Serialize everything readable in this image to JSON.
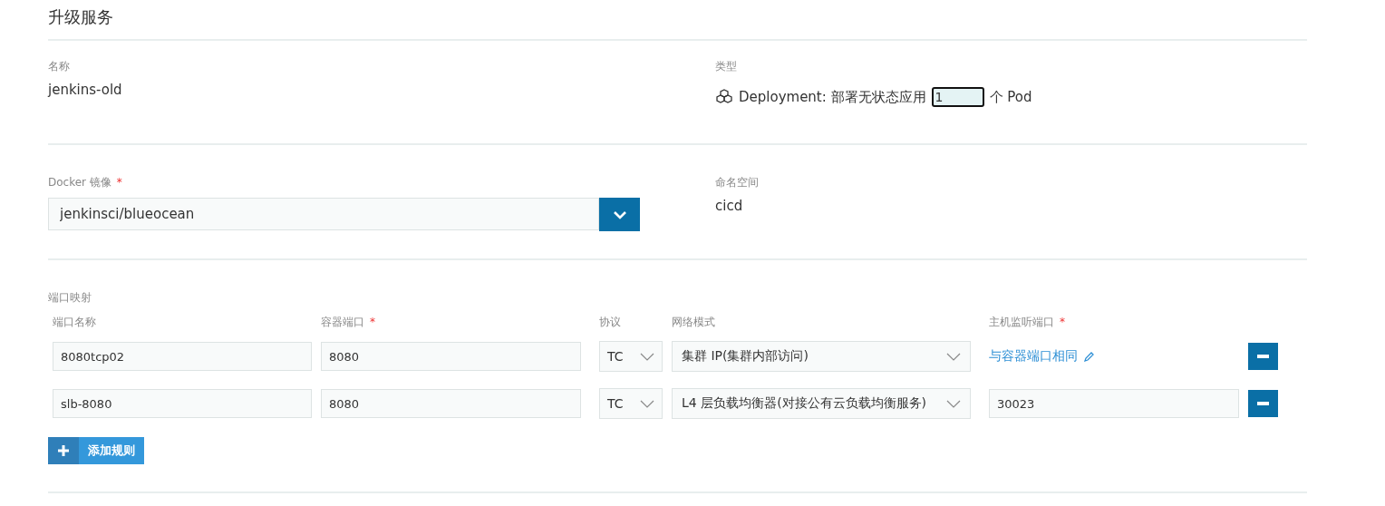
{
  "title": "升级服务",
  "name": {
    "label": "名称",
    "value": "jenkins-old"
  },
  "type": {
    "label": "类型",
    "text": "Deployment: 部署无状态应用",
    "replicas": "1",
    "unit": "个 Pod"
  },
  "image": {
    "label": "Docker 镜像",
    "required_mark": "*",
    "value": "jenkinsci/blueocean"
  },
  "namespace": {
    "label": "命名空间",
    "value": "cicd"
  },
  "ports": {
    "label": "端口映射",
    "columns": [
      {
        "label": "端口名称"
      },
      {
        "label": "容器端口",
        "required_mark": "*"
      },
      {
        "label": "协议"
      },
      {
        "label": "网络模式"
      },
      {
        "label": "主机监听端口",
        "required_mark": "*"
      }
    ],
    "rows": [
      {
        "name": "8080tcp02",
        "container_port": "8080",
        "protocol": "TC",
        "mode": "集群 IP(集群内部访问)",
        "host": {
          "kind": "same",
          "text": "与容器端口相同"
        }
      },
      {
        "name": "slb-8080",
        "container_port": "8080",
        "protocol": "TC",
        "mode": "L4 层负载均衡器(对接公有云负载均衡服务)",
        "host": {
          "kind": "input",
          "text": "30023"
        }
      }
    ],
    "add_button": "添加规则"
  }
}
